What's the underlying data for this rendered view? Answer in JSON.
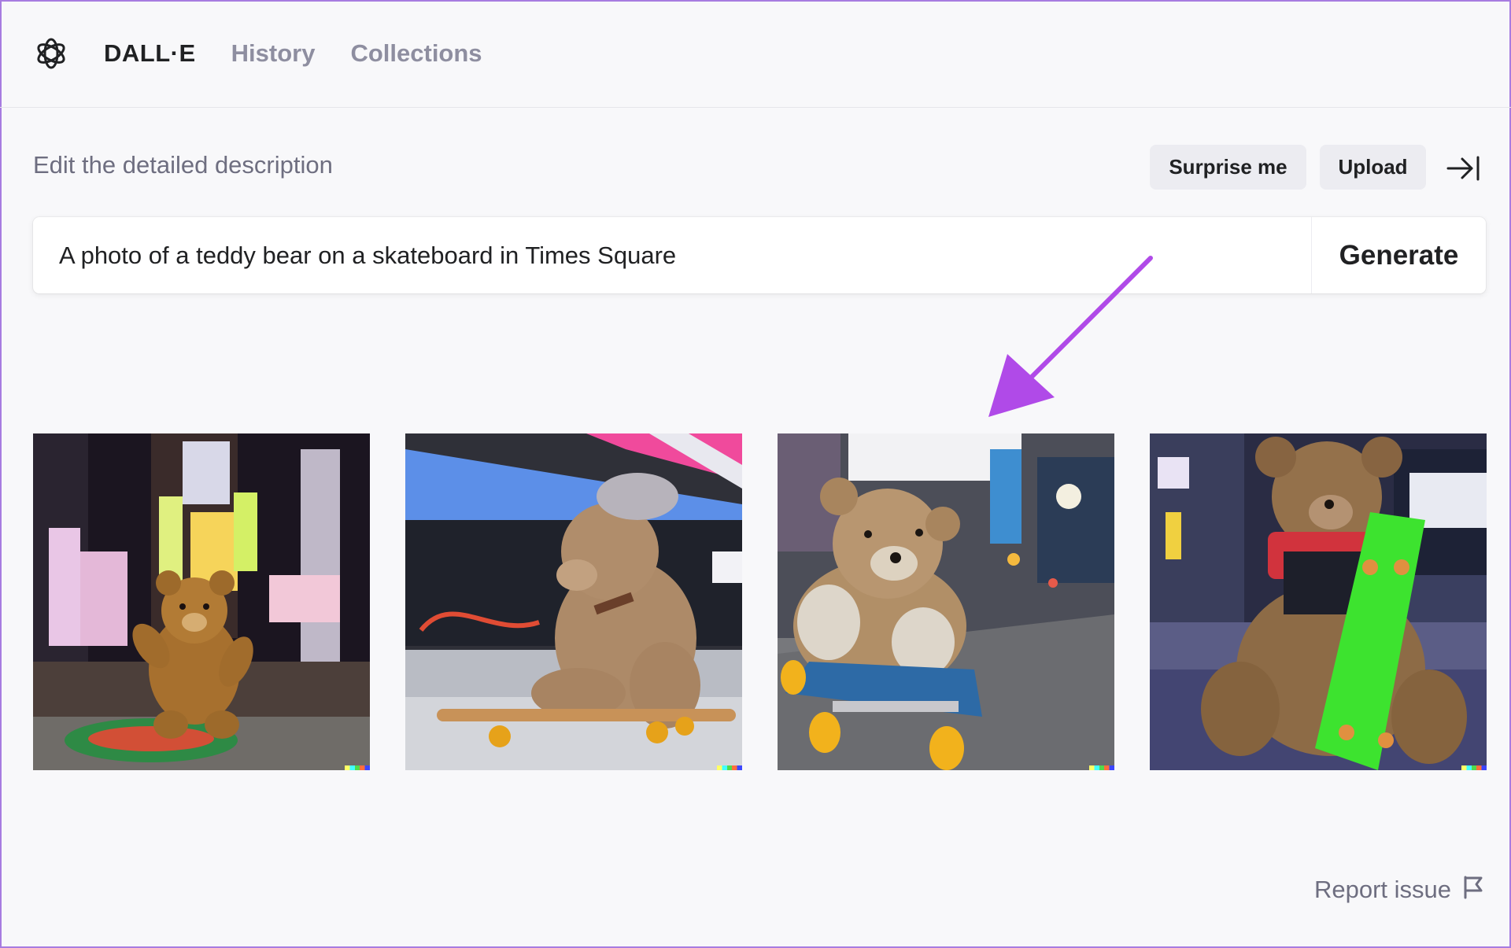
{
  "header": {
    "logo_icon": "openai-logo-icon",
    "brand": "DALL·E",
    "nav": [
      {
        "label": "History"
      },
      {
        "label": "Collections"
      }
    ]
  },
  "prompt": {
    "edit_label": "Edit the detailed description",
    "surprise_label": "Surprise me",
    "upload_label": "Upload",
    "collapse_icon": "arrow-right-to-bar-icon",
    "value": "A photo of a teddy bear on a skateboard in Times Square",
    "generate_label": "Generate"
  },
  "annotation": {
    "arrow_color": "#b04ae8"
  },
  "results": {
    "images": [
      {
        "description": "teddy-bear-night-times-square"
      },
      {
        "description": "teddy-bear-cap-skateboard"
      },
      {
        "description": "teddy-bear-blue-skateboard"
      },
      {
        "description": "teddy-bear-green-skateboard"
      }
    ]
  },
  "footer": {
    "report_label": "Report issue",
    "report_icon": "flag-icon"
  },
  "colors": {
    "accent": "#a77ce0",
    "muted_text": "#6e6e80",
    "nav_inactive": "#8e8ea0"
  }
}
